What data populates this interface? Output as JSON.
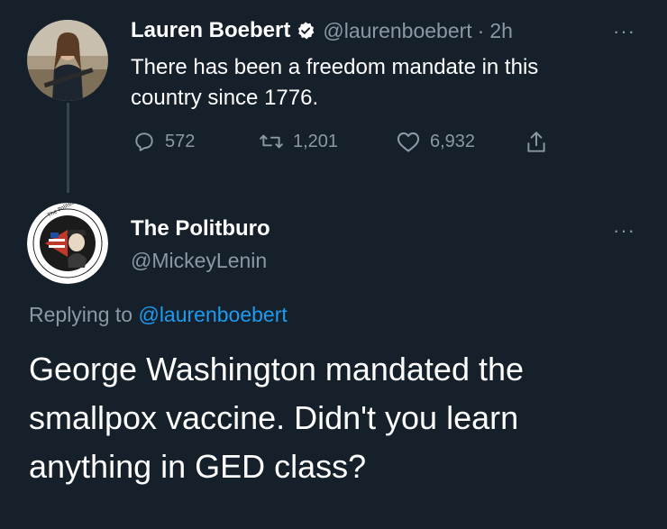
{
  "tweet1": {
    "author_name": "Lauren Boebert",
    "handle": "@laurenboebert",
    "separator": "·",
    "time": "2h",
    "more": "···",
    "text_line1": "There has been a freedom mandate in this",
    "text_line2": "country since 1776.",
    "replies": "572",
    "retweets": "1,201",
    "likes": "6,932"
  },
  "tweet2": {
    "author_name": "The Politburo",
    "handle": "@MickeyLenin",
    "more": "···",
    "avatar_ring_text": "The Politburo of Freedom Defense",
    "replying_prefix": "Replying to",
    "replying_handle": "@laurenboebert",
    "text_line1": "George Washington mandated the",
    "text_line2": "smallpox vaccine. Didn't you learn",
    "text_line3": "anything in GED class?"
  },
  "colors": {
    "background": "#15202b",
    "muted": "#8b98a5",
    "link": "#1d9bf0",
    "thread_line": "#38444d"
  }
}
